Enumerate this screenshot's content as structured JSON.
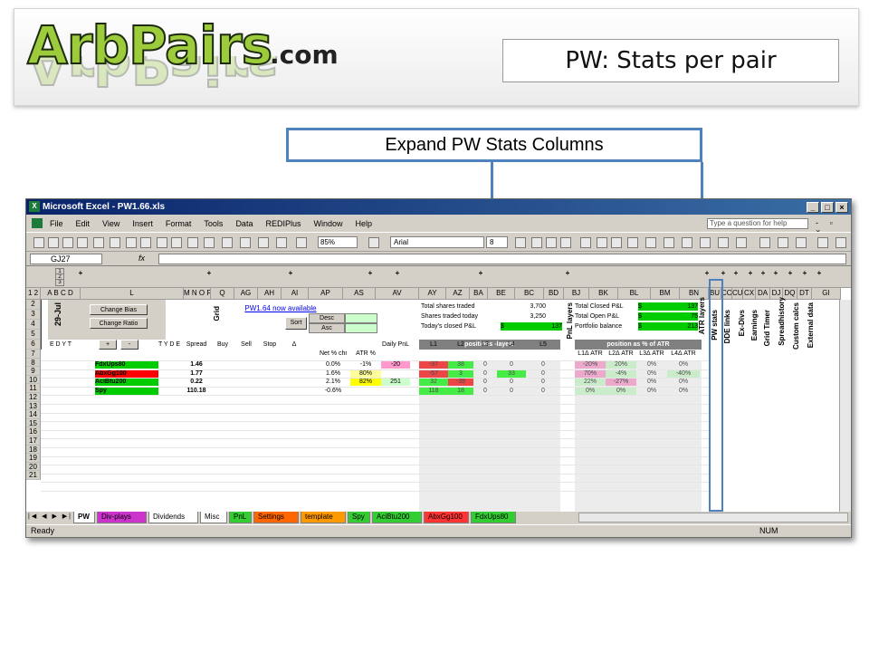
{
  "slide": {
    "logo_text": "ArbPairs",
    "logo_suffix": ".com",
    "title": "PW: Stats per pair",
    "callout": "Expand PW Stats Columns"
  },
  "excel": {
    "window_title": "Microsoft Excel - PW1.66.xls",
    "menu": [
      "File",
      "Edit",
      "View",
      "Insert",
      "Format",
      "Tools",
      "Data",
      "REDIPlus",
      "Window",
      "Help"
    ],
    "help_box": "Type a question for help",
    "zoom": "85%",
    "font_name": "Arial",
    "font_size": "8",
    "name_box": "GJ27",
    "fx": "fx",
    "columns": [
      "A",
      "B",
      "C",
      "D",
      "L",
      "M",
      "N",
      "O",
      "P",
      "Q",
      "AG",
      "AH",
      "AI",
      "AP",
      "AS",
      "AV",
      "AY",
      "AZ",
      "BA",
      "BE",
      "BC",
      "BD",
      "BJ",
      "BK",
      "BL",
      "BM",
      "BN",
      "BU",
      "CC",
      "CU",
      "CX",
      "DA",
      "DJ",
      "DQ",
      "DT",
      "GI"
    ],
    "rows": [
      "1",
      "2",
      "3",
      "5",
      "6",
      "7",
      "8",
      "9",
      "10",
      "11",
      "12",
      "13",
      "14",
      "15",
      "16",
      "17",
      "18",
      "19",
      "20",
      "21"
    ],
    "controls": {
      "change_bias": "Change Bias",
      "change_ratio": "Change Ratio",
      "date": "29-Jul",
      "grid_label": "Grid",
      "version_link": "PW1.64 now available",
      "sort": "Sort",
      "desc": "Desc",
      "asc": "Asc",
      "plus": "+",
      "minus": "-"
    },
    "summary": {
      "total_shares_label": "Total shares traded",
      "total_shares": "3,700",
      "today_shares_label": "Shares traded today",
      "today_shares": "3,250",
      "today_pnl_label": "Today's closed P&L",
      "today_pnl_cur": "$",
      "today_pnl": "137",
      "total_closed_label": "Total Closed P&L",
      "total_closed_cur": "$",
      "total_closed": "137",
      "total_open_label": "Total Open P&L",
      "total_open_cur": "$",
      "total_open": "75",
      "portfolio_label": "Portfolio balance",
      "portfolio_cur": "$",
      "portfolio": "213"
    },
    "vertical_labels": {
      "pnl_layers": "PnL layers",
      "atr_layers": "ATR layers",
      "pw_stats": "PW stats",
      "dde_links": "DDE links",
      "ex_divs": "Ex-Divs",
      "earnings": "Earnings",
      "grid_timer": "Grid Timer",
      "spreadhistory": "Spreadhistory",
      "custom_calcs": "Custom calcs",
      "external_data": "External data"
    },
    "section_headers": {
      "positions_layers": "positions -layers",
      "position_atr": "position as % of ATR"
    },
    "headers_row6": {
      "edyt": "E D Y T",
      "tyde": "T Y D E",
      "spread": "Spread",
      "buy": "Buy",
      "sell": "Sell",
      "stop": "Stop",
      "delta": "Δ",
      "netchg": "Net % chng",
      "atr": "ATR %",
      "daily": "Daily PnL",
      "l1": "L1",
      "l2": "L2",
      "l3": "L3",
      "l4": "L4",
      "l5": "L5",
      "l1atr": "L1Δ ATR",
      "l2atr": "L2Δ ATR",
      "l3atr": "L3Δ ATR",
      "l4atr": "L4Δ ATR"
    },
    "pairs": [
      {
        "name": "FdxUps80",
        "color": "#00cc00",
        "spread": "1.46",
        "net": "0.0%",
        "atr": "-1%",
        "atr_bg": "#ffffff",
        "daily": "-20",
        "daily_bg": "#ff99cc",
        "l1": "-37",
        "l1_bg": "#ff0000",
        "l2": "38",
        "l2_bg": "#00ff00",
        "l3": "0",
        "l4": "0",
        "l5": "0",
        "a1": "-20%",
        "a1_bg": "#ff99cc",
        "a2": "20%",
        "a2_bg": "#ccffcc",
        "a3": "0%",
        "a4": "0%",
        "a4_bg": "#ffffff"
      },
      {
        "name": "AbxGg100",
        "color": "#ff0000",
        "spread": "1.77",
        "net": "1.6%",
        "atr": "80%",
        "atr_bg": "#ffff99",
        "daily": "",
        "daily_bg": "#ffffff",
        "l1": "-57",
        "l1_bg": "#ff0000",
        "l2": "3",
        "l2_bg": "#00ff00",
        "l3": "0",
        "l4": "33",
        "l5": "0",
        "a1": "70%",
        "a1_bg": "#ff99cc",
        "a2": "-4%",
        "a2_bg": "#ccffcc",
        "a3": "0%",
        "a4": "-40%",
        "a4_bg": "#ccffcc"
      },
      {
        "name": "AciBtu200",
        "color": "#00cc00",
        "spread": "0.22",
        "net": "2.1%",
        "atr": "82%",
        "atr_bg": "#ffff00",
        "daily": "251",
        "daily_bg": "#ccffcc",
        "l1": "32",
        "l1_bg": "#00ff00",
        "l2": "-39",
        "l2_bg": "#ff0000",
        "l3": "0",
        "l4": "0",
        "l5": "0",
        "a1": "22%",
        "a1_bg": "#ccffcc",
        "a2": "-27%",
        "a2_bg": "#ff99cc",
        "a3": "0%",
        "a4": "0%",
        "a4_bg": "#ffffff"
      },
      {
        "name": "Spy",
        "color": "#00cc00",
        "spread": "110.18",
        "net": "-0.6%",
        "atr": "",
        "atr_bg": "#ffffff",
        "daily": "",
        "daily_bg": "#ffffff",
        "l1": "118",
        "l1_bg": "#00ff00",
        "l2": "18",
        "l2_bg": "#00ff00",
        "l3": "0",
        "l4": "0",
        "l5": "0",
        "a1": "0%",
        "a1_bg": "#ccffcc",
        "a2": "0%",
        "a2_bg": "#ccffcc",
        "a3": "0%",
        "a4": "0%",
        "a4_bg": "#ffffff"
      }
    ],
    "tabs": [
      {
        "label": "PW",
        "color": "#ffffff"
      },
      {
        "label": "Div-plays",
        "color": "#cc33cc"
      },
      {
        "label": "Dividends",
        "color": "#ffffff"
      },
      {
        "label": "Misc",
        "color": "#ffffff"
      },
      {
        "label": "PnL",
        "color": "#33cc33"
      },
      {
        "label": "Settings",
        "color": "#ff6600"
      },
      {
        "label": "template",
        "color": "#ff9900"
      },
      {
        "label": "Spy",
        "color": "#33cc33"
      },
      {
        "label": "AciBtu200",
        "color": "#33cc33"
      },
      {
        "label": "AbxGg100",
        "color": "#ff3333"
      },
      {
        "label": "FdxUps80",
        "color": "#33cc33"
      }
    ],
    "status_ready": "Ready",
    "status_num": "NUM"
  },
  "colors": {
    "callout_border": "#4f81bd",
    "logo_green": "#9ccc3c",
    "excel_face": "#d4d0c8"
  }
}
